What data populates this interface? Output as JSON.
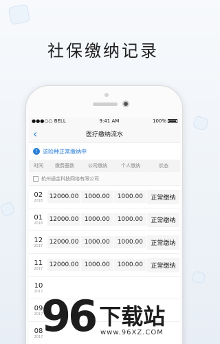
{
  "page": {
    "title": "社保缴纳记录"
  },
  "status_bar": {
    "carrier": "●●●○○ BELL",
    "time": "9:41 AM",
    "battery": "100%"
  },
  "nav": {
    "title": "医疗缴纳流水"
  },
  "notice": {
    "text": "该险种正常缴纳中"
  },
  "table": {
    "headers": [
      "时间",
      "缴费基数",
      "公司缴纳",
      "个人缴纳",
      "状态"
    ],
    "company": "杭州通金科技网络有限公司",
    "rows": [
      {
        "month": "02",
        "year": "2018",
        "base": "12000.00",
        "company": "1000.00",
        "personal": "1000.00",
        "status": "正常缴纳"
      },
      {
        "month": "01",
        "year": "2018",
        "base": "12000.00",
        "company": "1000.00",
        "personal": "1000.00",
        "status": "正常缴纳"
      },
      {
        "month": "12",
        "year": "2017",
        "base": "12000.00",
        "company": "1000.00",
        "personal": "1000.00",
        "status": "正常缴纳"
      },
      {
        "month": "11",
        "year": "2017",
        "base": "12000.00",
        "company": "1000.00",
        "personal": "1000.00",
        "status": "正常缴纳"
      },
      {
        "month": "10",
        "year": "2017",
        "base": "",
        "company": "",
        "personal": "",
        "status": ""
      },
      {
        "month": "09",
        "year": "2017",
        "base": "",
        "company": "",
        "personal": "",
        "status": ""
      },
      {
        "month": "08",
        "year": "2017",
        "base": "",
        "company": "",
        "personal": "",
        "status": ""
      }
    ]
  },
  "watermark": {
    "number": "96",
    "text": "下载站",
    "url": "www.96XZ.COM"
  },
  "colors": {
    "accent": "#2b7fd6",
    "text": "#222222",
    "muted": "#888888"
  },
  "icons": {
    "back": "chevron-left-icon",
    "info": "info-icon",
    "company": "building-icon"
  }
}
